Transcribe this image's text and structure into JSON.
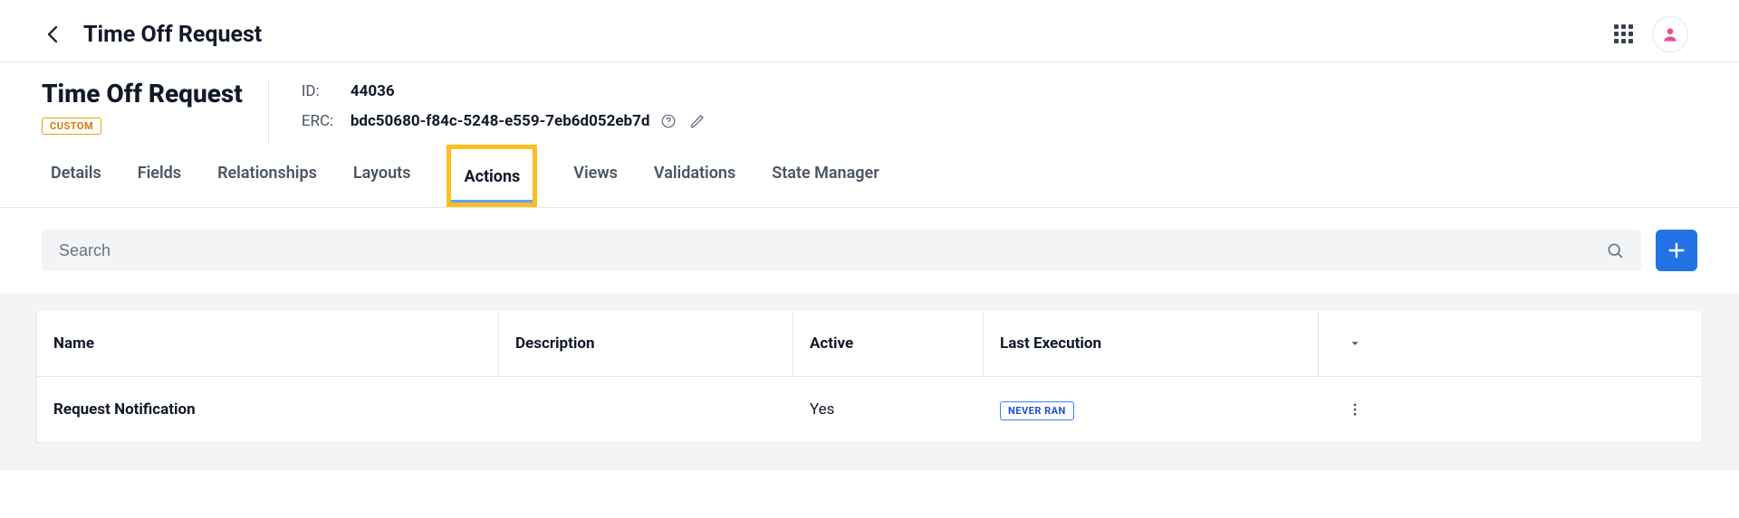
{
  "header": {
    "page_title": "Time Off Request"
  },
  "object": {
    "name": "Time Off Request",
    "badge": "CUSTOM",
    "id_label": "ID:",
    "id_value": "44036",
    "erc_label": "ERC:",
    "erc_value": "bdc50680-f84c-5248-e559-7eb6d052eb7d"
  },
  "tabs": [
    {
      "label": "Details",
      "active": false
    },
    {
      "label": "Fields",
      "active": false
    },
    {
      "label": "Relationships",
      "active": false
    },
    {
      "label": "Layouts",
      "active": false
    },
    {
      "label": "Actions",
      "active": true
    },
    {
      "label": "Views",
      "active": false
    },
    {
      "label": "Validations",
      "active": false
    },
    {
      "label": "State Manager",
      "active": false
    }
  ],
  "search": {
    "placeholder": "Search"
  },
  "table": {
    "columns": [
      "Name",
      "Description",
      "Active",
      "Last Execution"
    ],
    "rows": [
      {
        "name": "Request Notification",
        "description": "",
        "active": "Yes",
        "last_execution": "NEVER RAN"
      }
    ]
  }
}
